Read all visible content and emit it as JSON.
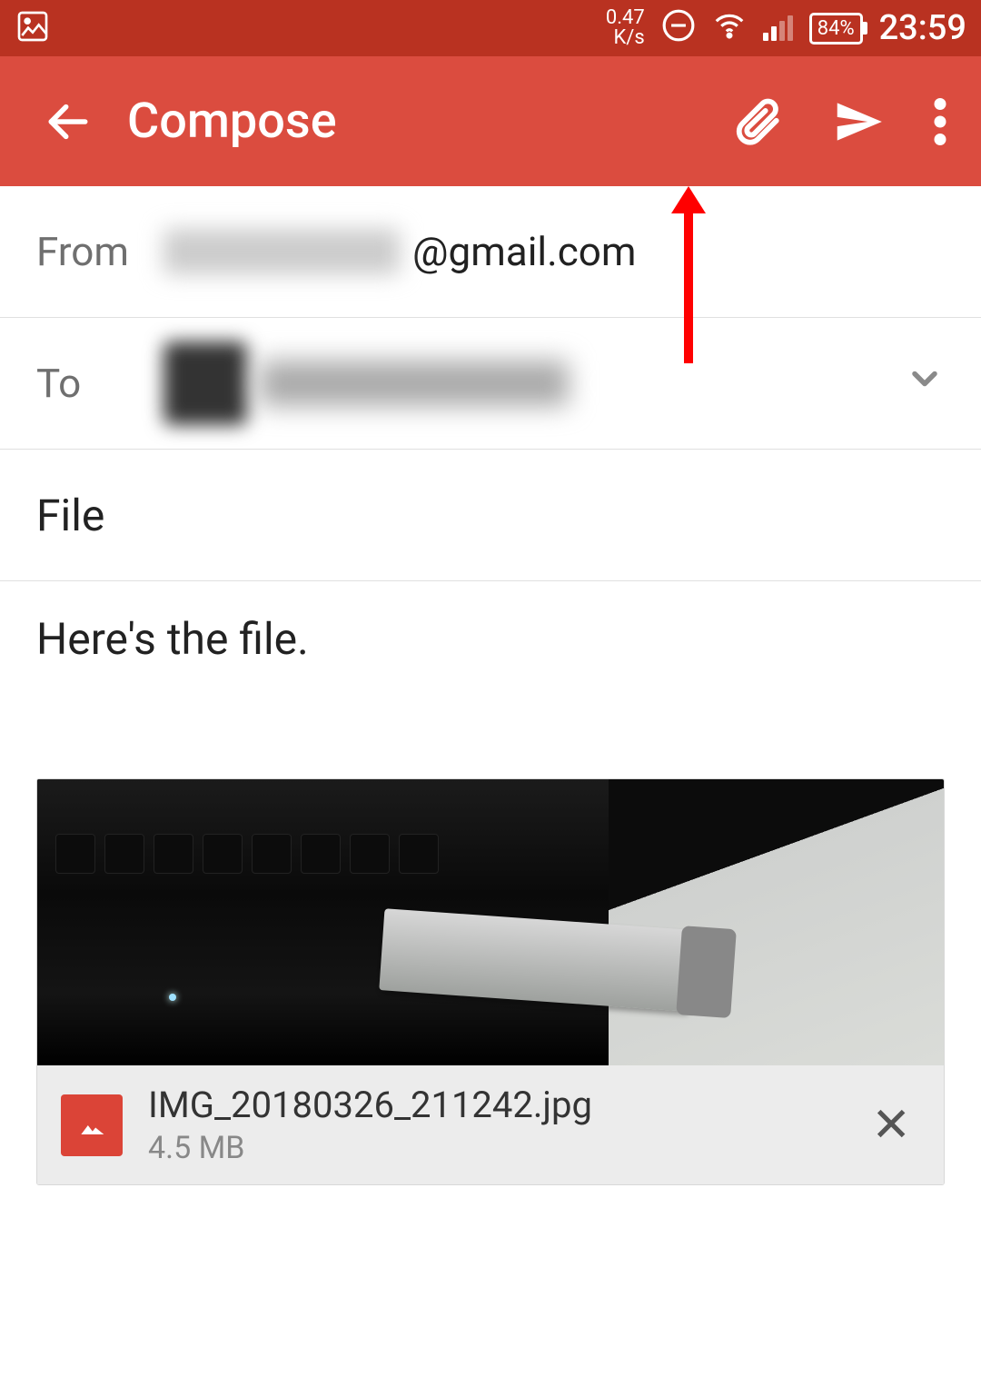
{
  "status": {
    "net_speed_top": "0.47",
    "net_speed_unit": "K/s",
    "battery_percent": "84%",
    "time": "23:59"
  },
  "appbar": {
    "title": "Compose"
  },
  "compose": {
    "from_label": "From",
    "from_domain": "@gmail.com",
    "to_label": "To",
    "subject": "File",
    "body": "Here's the file."
  },
  "attachment": {
    "filename": "IMG_20180326_211242.jpg",
    "size": "4.5 MB"
  }
}
